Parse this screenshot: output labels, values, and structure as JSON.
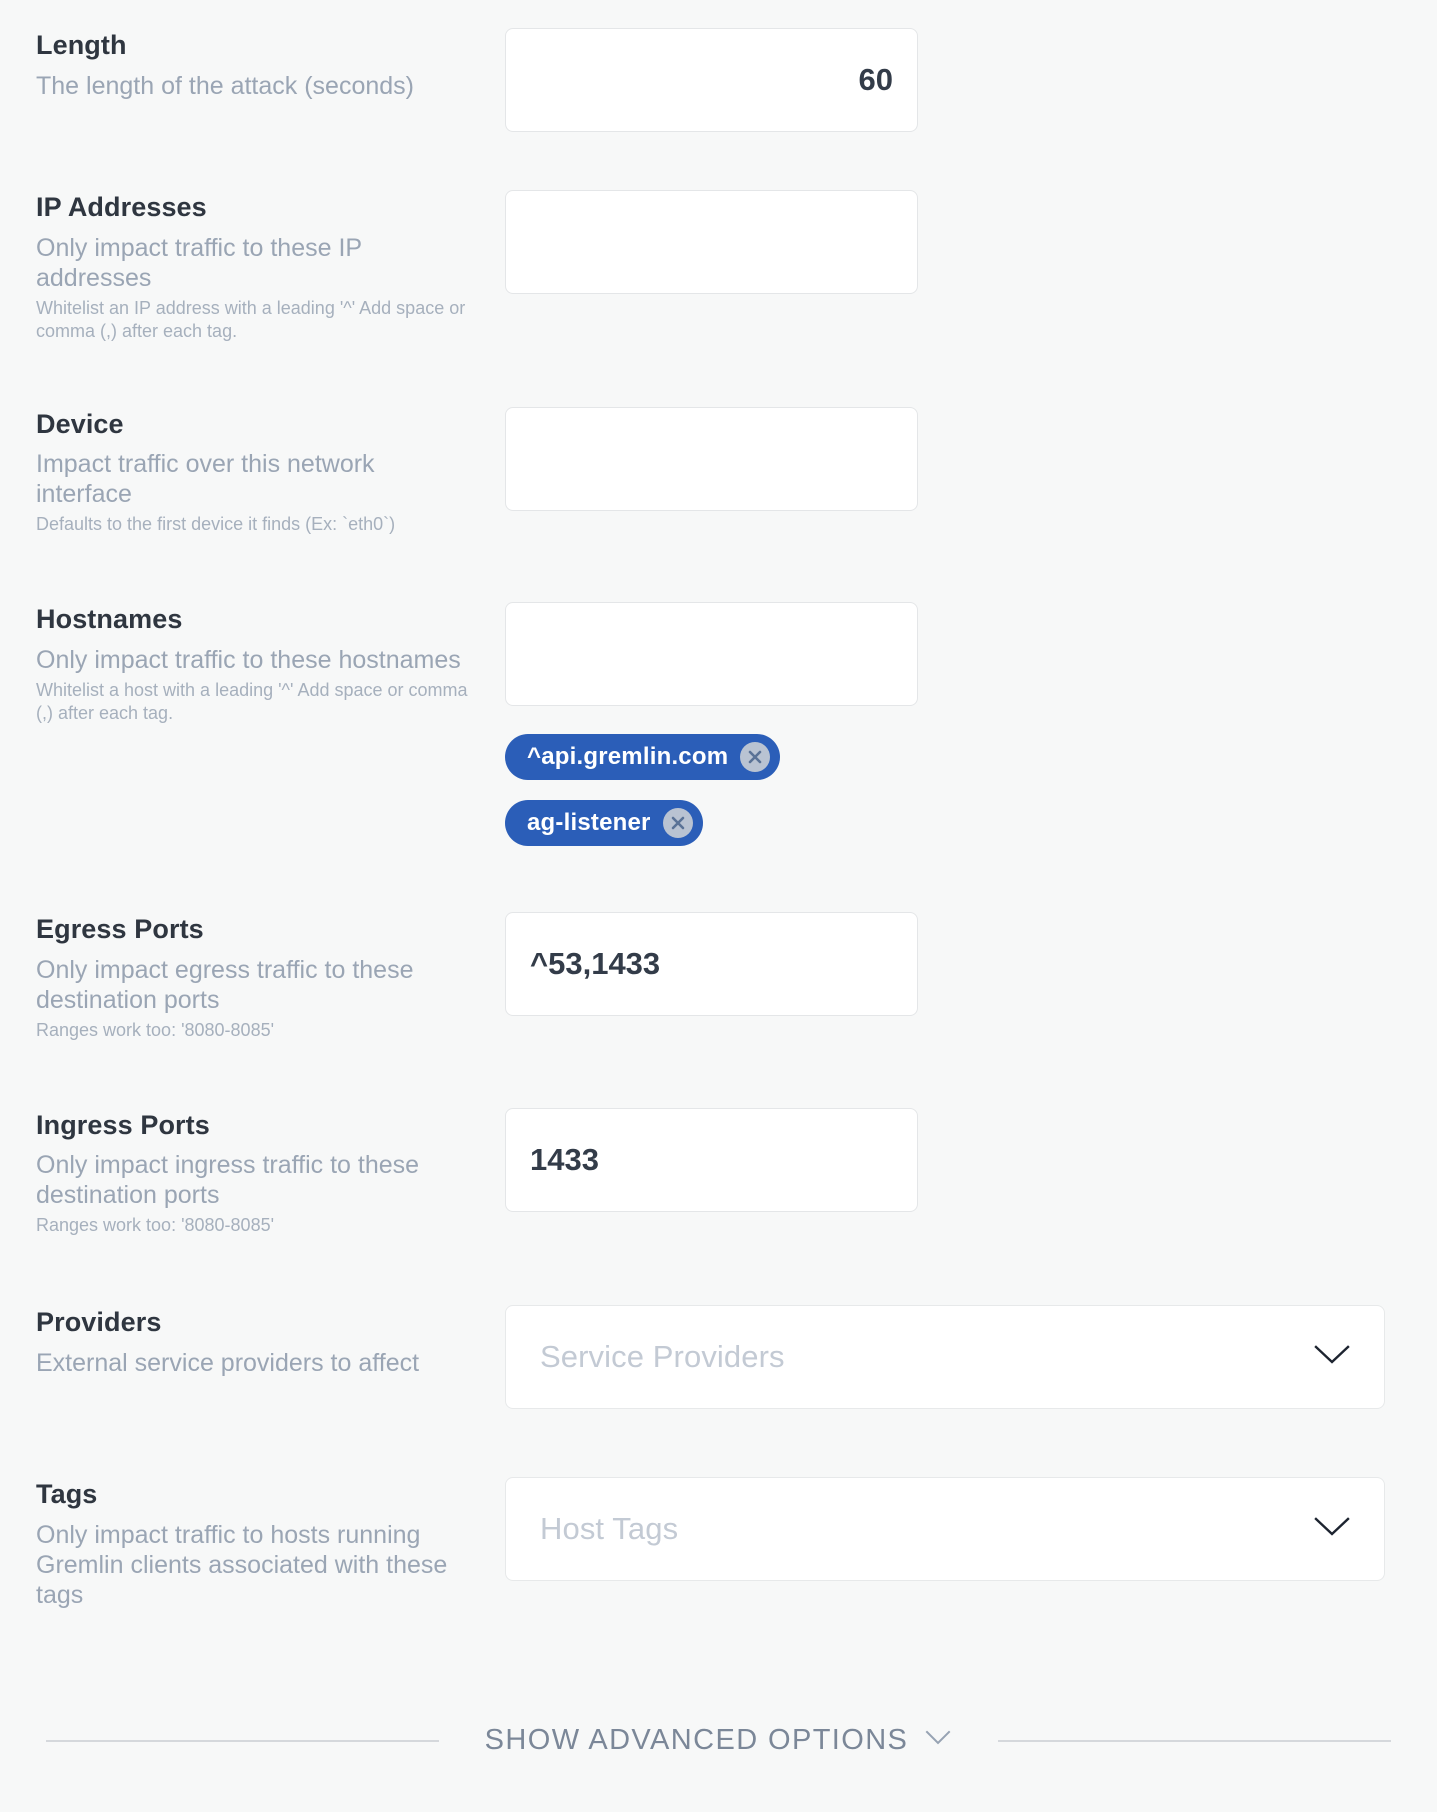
{
  "fields": [
    {
      "title": "Length",
      "desc": "The length of the attack (seconds)",
      "hint": "",
      "value": "60",
      "placeholder": ""
    },
    {
      "title": "IP Addresses",
      "desc": "Only impact traffic to these IP addresses",
      "hint": "Whitelist an IP address with a leading '^' Add space or comma (,) after each tag.",
      "value": "",
      "placeholder": ""
    },
    {
      "title": "Device",
      "desc": "Impact traffic over this network interface",
      "hint": "Defaults to the first device it finds (Ex: `eth0`)",
      "value": "",
      "placeholder": ""
    },
    {
      "title": "Hostnames",
      "desc": "Only impact traffic to these hostnames",
      "hint": "Whitelist a host with a leading '^' Add space or comma (,) after each tag.",
      "value": "",
      "placeholder": ""
    },
    {
      "title": "Egress Ports",
      "desc": "Only impact egress traffic to these destination ports",
      "hint": "Ranges work too: '8080-8085'",
      "value": "^53,1433",
      "placeholder": ""
    },
    {
      "title": "Ingress Ports",
      "desc": "Only impact ingress traffic to these destination ports",
      "hint": "Ranges work too: '8080-8085'",
      "value": "1433",
      "placeholder": ""
    },
    {
      "title": "Providers",
      "desc": "External service providers to affect",
      "hint": "",
      "value": "",
      "placeholder": "Service Providers"
    },
    {
      "title": "Tags",
      "desc": "Only impact traffic to hosts running Gremlin clients associated with these tags",
      "hint": "",
      "value": "",
      "placeholder": "Host Tags"
    }
  ],
  "hostname_tags": [
    {
      "label": "^api.gremlin.com",
      "remove_icon": "close-icon"
    },
    {
      "label": "ag-listener",
      "remove_icon": "close-icon"
    }
  ],
  "dropdown_icon": "chevron-down-icon",
  "footer": {
    "label": "SHOW ADVANCED OPTIONS",
    "icon": "chevron-down-icon"
  },
  "colors": {
    "tag_background": "#2b5eb8",
    "tag_text": "#ffffff",
    "tag_remove_background": "#b9c3d2",
    "page_background": "#f7f8f8",
    "input_background": "#ffffff",
    "title_text": "#2f3640",
    "desc_text": "#9aa5b4"
  }
}
